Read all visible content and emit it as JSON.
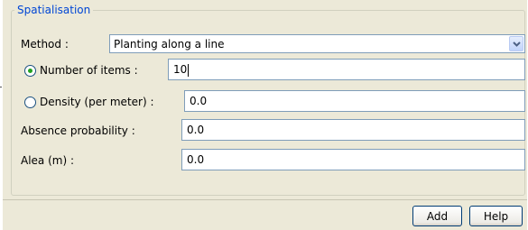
{
  "group": {
    "legend": "Spatialisation"
  },
  "method": {
    "label": "Method :",
    "selected": "Planting along a line"
  },
  "number_of_items": {
    "label": "Number of items :",
    "value": "10",
    "checked": true
  },
  "density": {
    "label": "Density (per meter) :",
    "value": "0.0",
    "checked": false
  },
  "absence_probability": {
    "label": "Absence probability :",
    "value": "0.0"
  },
  "alea": {
    "label": "Alea (m) :",
    "value": "0.0"
  },
  "buttons": {
    "add": "Add",
    "help": "Help"
  },
  "colors": {
    "panel_bg": "#ece9d8",
    "legend_text": "#0046d5",
    "field_border": "#7f9db9",
    "radio_dot": "#21a121"
  },
  "icons": {
    "dropdown_arrow": "chevron-down-icon",
    "radio_selected": "radio-checked-icon",
    "radio_unselected": "radio-unchecked-icon"
  }
}
